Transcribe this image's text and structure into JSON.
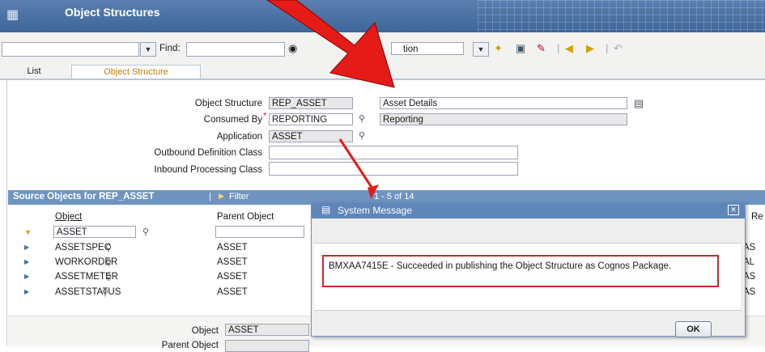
{
  "app": {
    "title": "Object Structures"
  },
  "toolbar": {
    "find_label": "Find:",
    "select_value": "",
    "find_value": "",
    "action_value": "tion"
  },
  "tabs": [
    {
      "label": "List",
      "active": false
    },
    {
      "label": "Object Structure",
      "active": true
    }
  ],
  "form": {
    "object_structure": {
      "label": "Object Structure",
      "value": "REP_ASSET",
      "description": "Asset Details"
    },
    "consumed_by": {
      "label": "Consumed By",
      "value": "REPORTING",
      "description": "Reporting",
      "required": true
    },
    "application": {
      "label": "Application",
      "value": "ASSET"
    },
    "outbound": {
      "label": "Outbound Definition Class",
      "value": ""
    },
    "inbound": {
      "label": "Inbound Processing Class",
      "value": ""
    }
  },
  "source_table": {
    "title": "Source Objects for REP_ASSET",
    "filter_label": "Filter",
    "pagination": "1 - 5 of 14",
    "columns": [
      "Object",
      "Parent Object",
      "Re"
    ],
    "filter_row": {
      "object": "ASSET",
      "parent": ""
    },
    "rows": [
      {
        "object": "ASSETSPEC",
        "parent": "ASSET",
        "rel": "AS"
      },
      {
        "object": "WORKORDER",
        "parent": "ASSET",
        "rel": "AL"
      },
      {
        "object": "ASSETMETER",
        "parent": "ASSET",
        "rel": "AS"
      },
      {
        "object": "ASSETSTATUS",
        "parent": "ASSET",
        "rel": "AS"
      }
    ]
  },
  "details": {
    "object_label": "Object",
    "object_value": "ASSET",
    "parent_label": "Parent Object"
  },
  "dialog": {
    "title": "System Message",
    "message": "BMXAA7415E - Succeeded in publishing the Object Structure as Cognos Package.",
    "ok_label": "OK"
  },
  "colors": {
    "arrow": "#e41b17",
    "header_blue": "#5f86b8",
    "highlight_box": "#c62a2a"
  }
}
